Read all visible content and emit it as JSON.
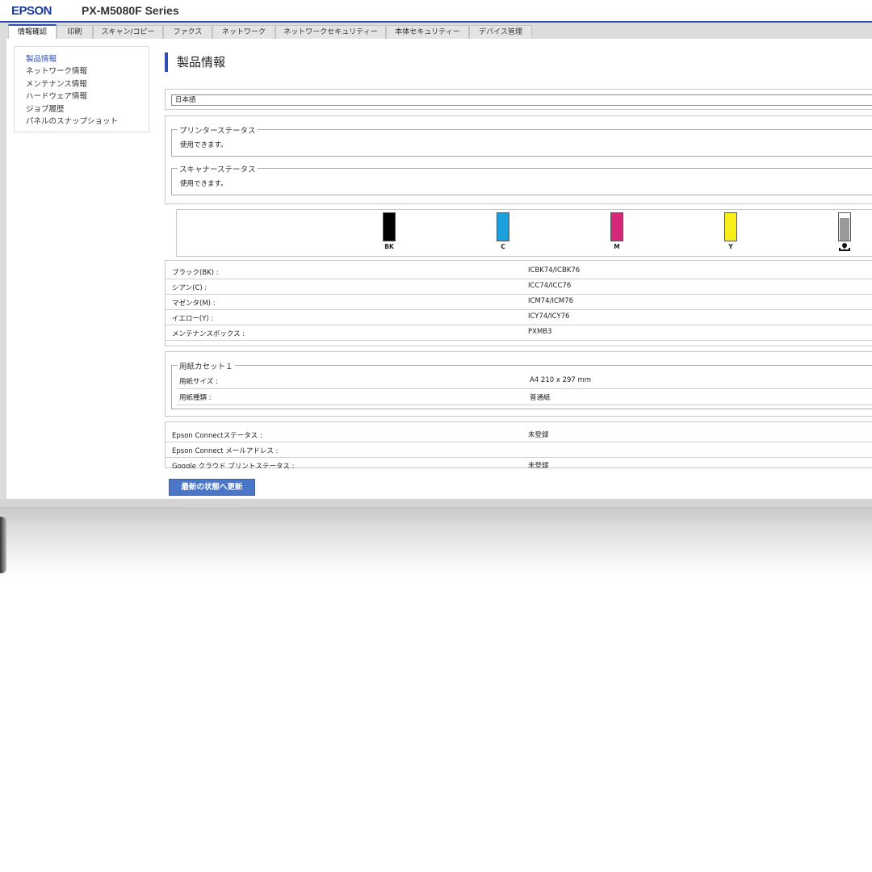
{
  "header": {
    "logo": "EPSON",
    "model": "PX-M5080F Series"
  },
  "tabs": [
    {
      "label": "情報確認"
    },
    {
      "label": "印刷"
    },
    {
      "label": "スキャン/コピー"
    },
    {
      "label": "ファクス"
    },
    {
      "label": "ネットワーク"
    },
    {
      "label": "ネットワークセキュリティー"
    },
    {
      "label": "本体セキュリティー"
    },
    {
      "label": "デバイス管理"
    }
  ],
  "sidebar": {
    "items": [
      {
        "label": "製品情報"
      },
      {
        "label": "ネットワーク情報"
      },
      {
        "label": "メンテナンス情報"
      },
      {
        "label": "ハードウェア情報"
      },
      {
        "label": "ジョブ履歴"
      },
      {
        "label": "パネルのスナップショット"
      }
    ]
  },
  "main": {
    "title": "製品情報",
    "language": "日本語",
    "printer_status": {
      "legend": "プリンターステータス",
      "text": "使用できます。"
    },
    "scanner_status": {
      "legend": "スキャナーステータス",
      "text": "使用できます。"
    },
    "inks": [
      {
        "label": "BK",
        "color": "#000000",
        "level": 1.0
      },
      {
        "label": "C",
        "color": "#1aa0dc",
        "level": 1.0
      },
      {
        "label": "M",
        "color": "#d6287a",
        "level": 1.0
      },
      {
        "label": "Y",
        "color": "#f7ee1a",
        "level": 1.0
      }
    ],
    "maintenance_icon": "maintenance-box-icon",
    "cartridges": [
      {
        "label": "ブラック(BK) :",
        "value": "ICBK74/ICBK76"
      },
      {
        "label": "シアン(C) :",
        "value": "ICC74/ICC76"
      },
      {
        "label": "マゼンタ(M) :",
        "value": "ICM74/ICM76"
      },
      {
        "label": "イエロー(Y) :",
        "value": "ICY74/ICY76"
      },
      {
        "label": "メンテナンスボックス :",
        "value": "PXMB3"
      }
    ],
    "paper_cassette": {
      "legend": "用紙カセット１",
      "rows": [
        {
          "label": "用紙サイズ :",
          "value": "A4 210 x 297 mm"
        },
        {
          "label": "用紙種類 :",
          "value": "普通紙"
        }
      ]
    },
    "connect": [
      {
        "label": "Epson Connectステータス :",
        "value": "未登録"
      },
      {
        "label": "Epson Connect メールアドレス :",
        "value": ""
      },
      {
        "label": "Google クラウド プリントステータス :",
        "value": "未登録"
      }
    ],
    "refresh_label": "最新の状態へ更新"
  }
}
